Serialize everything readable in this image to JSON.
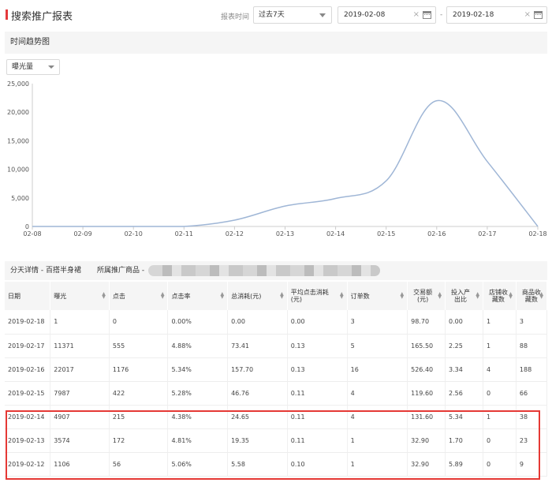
{
  "header": {
    "title": "搜索推广报表",
    "date_label": "报表时间",
    "period_select": "过去7天",
    "start_date": "2019-02-08",
    "end_date": "2019-02-18",
    "range_separator": "-",
    "clear_symbol": "×"
  },
  "trend": {
    "section_title": "时间趋势图",
    "metric_select": "曝光量"
  },
  "chart_data": {
    "type": "line",
    "title": "",
    "xlabel": "",
    "ylabel": "",
    "categories": [
      "02-08",
      "02-09",
      "02-10",
      "02-11",
      "02-12",
      "02-13",
      "02-14",
      "02-15",
      "02-16",
      "02-17",
      "02-18"
    ],
    "y_ticks": [
      "0",
      "5,000",
      "10,000",
      "15,000",
      "20,000",
      "25,000"
    ],
    "ylim": [
      0,
      25000
    ],
    "grid": false,
    "series": [
      {
        "values": [
          0,
          0,
          0,
          0,
          1106,
          3574,
          4907,
          7987,
          22017,
          11371,
          1
        ],
        "color": "#9fb6d6"
      }
    ]
  },
  "detail": {
    "title": "分天详情 - 百搭半身裙",
    "product_label": "所属推广商品 -",
    "columns": [
      "日期",
      "曝光",
      "点击",
      "点击率",
      "总消耗(元)",
      "平均点击消耗(元)",
      "订单数",
      "交易额(元)",
      "投入产出比",
      "店铺收藏数",
      "商品收藏数"
    ],
    "rows": [
      [
        "2019-02-18",
        "1",
        "0",
        "0.00%",
        "0.00",
        "0.00",
        "3",
        "98.70",
        "0.00",
        "1",
        "3"
      ],
      [
        "2019-02-17",
        "11371",
        "555",
        "4.88%",
        "73.41",
        "0.13",
        "5",
        "165.50",
        "2.25",
        "1",
        "88"
      ],
      [
        "2019-02-16",
        "22017",
        "1176",
        "5.34%",
        "157.70",
        "0.13",
        "16",
        "526.40",
        "3.34",
        "4",
        "188"
      ],
      [
        "2019-02-15",
        "7987",
        "422",
        "5.28%",
        "46.76",
        "0.11",
        "4",
        "119.60",
        "2.56",
        "0",
        "66"
      ],
      [
        "2019-02-14",
        "4907",
        "215",
        "4.38%",
        "24.65",
        "0.11",
        "4",
        "131.60",
        "5.34",
        "1",
        "38"
      ],
      [
        "2019-02-13",
        "3574",
        "172",
        "4.81%",
        "19.35",
        "0.11",
        "1",
        "32.90",
        "1.70",
        "0",
        "23"
      ],
      [
        "2019-02-12",
        "1106",
        "56",
        "5.06%",
        "5.58",
        "0.10",
        "1",
        "32.90",
        "5.89",
        "0",
        "9"
      ]
    ]
  },
  "colors": {
    "accent": "#e4393c",
    "highlight": "#e53935",
    "line": "#9fb6d6"
  }
}
